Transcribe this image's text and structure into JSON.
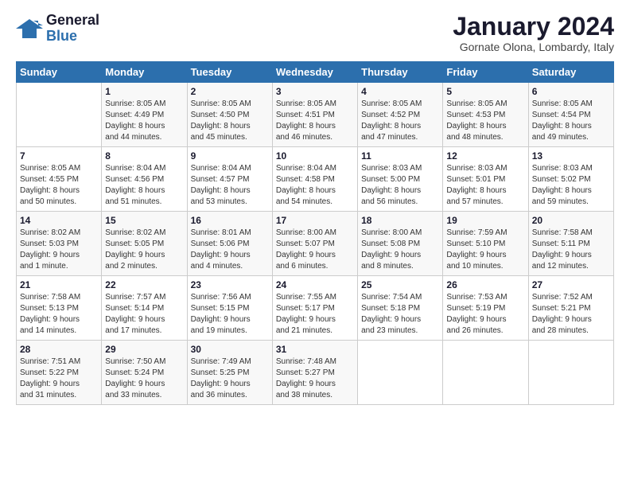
{
  "logo": {
    "text_general": "General",
    "text_blue": "Blue"
  },
  "header": {
    "title": "January 2024",
    "subtitle": "Gornate Olona, Lombardy, Italy"
  },
  "weekdays": [
    "Sunday",
    "Monday",
    "Tuesday",
    "Wednesday",
    "Thursday",
    "Friday",
    "Saturday"
  ],
  "weeks": [
    [
      {
        "num": "",
        "detail": ""
      },
      {
        "num": "1",
        "detail": "Sunrise: 8:05 AM\nSunset: 4:49 PM\nDaylight: 8 hours\nand 44 minutes."
      },
      {
        "num": "2",
        "detail": "Sunrise: 8:05 AM\nSunset: 4:50 PM\nDaylight: 8 hours\nand 45 minutes."
      },
      {
        "num": "3",
        "detail": "Sunrise: 8:05 AM\nSunset: 4:51 PM\nDaylight: 8 hours\nand 46 minutes."
      },
      {
        "num": "4",
        "detail": "Sunrise: 8:05 AM\nSunset: 4:52 PM\nDaylight: 8 hours\nand 47 minutes."
      },
      {
        "num": "5",
        "detail": "Sunrise: 8:05 AM\nSunset: 4:53 PM\nDaylight: 8 hours\nand 48 minutes."
      },
      {
        "num": "6",
        "detail": "Sunrise: 8:05 AM\nSunset: 4:54 PM\nDaylight: 8 hours\nand 49 minutes."
      }
    ],
    [
      {
        "num": "7",
        "detail": "Sunrise: 8:05 AM\nSunset: 4:55 PM\nDaylight: 8 hours\nand 50 minutes."
      },
      {
        "num": "8",
        "detail": "Sunrise: 8:04 AM\nSunset: 4:56 PM\nDaylight: 8 hours\nand 51 minutes."
      },
      {
        "num": "9",
        "detail": "Sunrise: 8:04 AM\nSunset: 4:57 PM\nDaylight: 8 hours\nand 53 minutes."
      },
      {
        "num": "10",
        "detail": "Sunrise: 8:04 AM\nSunset: 4:58 PM\nDaylight: 8 hours\nand 54 minutes."
      },
      {
        "num": "11",
        "detail": "Sunrise: 8:03 AM\nSunset: 5:00 PM\nDaylight: 8 hours\nand 56 minutes."
      },
      {
        "num": "12",
        "detail": "Sunrise: 8:03 AM\nSunset: 5:01 PM\nDaylight: 8 hours\nand 57 minutes."
      },
      {
        "num": "13",
        "detail": "Sunrise: 8:03 AM\nSunset: 5:02 PM\nDaylight: 8 hours\nand 59 minutes."
      }
    ],
    [
      {
        "num": "14",
        "detail": "Sunrise: 8:02 AM\nSunset: 5:03 PM\nDaylight: 9 hours\nand 1 minute."
      },
      {
        "num": "15",
        "detail": "Sunrise: 8:02 AM\nSunset: 5:05 PM\nDaylight: 9 hours\nand 2 minutes."
      },
      {
        "num": "16",
        "detail": "Sunrise: 8:01 AM\nSunset: 5:06 PM\nDaylight: 9 hours\nand 4 minutes."
      },
      {
        "num": "17",
        "detail": "Sunrise: 8:00 AM\nSunset: 5:07 PM\nDaylight: 9 hours\nand 6 minutes."
      },
      {
        "num": "18",
        "detail": "Sunrise: 8:00 AM\nSunset: 5:08 PM\nDaylight: 9 hours\nand 8 minutes."
      },
      {
        "num": "19",
        "detail": "Sunrise: 7:59 AM\nSunset: 5:10 PM\nDaylight: 9 hours\nand 10 minutes."
      },
      {
        "num": "20",
        "detail": "Sunrise: 7:58 AM\nSunset: 5:11 PM\nDaylight: 9 hours\nand 12 minutes."
      }
    ],
    [
      {
        "num": "21",
        "detail": "Sunrise: 7:58 AM\nSunset: 5:13 PM\nDaylight: 9 hours\nand 14 minutes."
      },
      {
        "num": "22",
        "detail": "Sunrise: 7:57 AM\nSunset: 5:14 PM\nDaylight: 9 hours\nand 17 minutes."
      },
      {
        "num": "23",
        "detail": "Sunrise: 7:56 AM\nSunset: 5:15 PM\nDaylight: 9 hours\nand 19 minutes."
      },
      {
        "num": "24",
        "detail": "Sunrise: 7:55 AM\nSunset: 5:17 PM\nDaylight: 9 hours\nand 21 minutes."
      },
      {
        "num": "25",
        "detail": "Sunrise: 7:54 AM\nSunset: 5:18 PM\nDaylight: 9 hours\nand 23 minutes."
      },
      {
        "num": "26",
        "detail": "Sunrise: 7:53 AM\nSunset: 5:19 PM\nDaylight: 9 hours\nand 26 minutes."
      },
      {
        "num": "27",
        "detail": "Sunrise: 7:52 AM\nSunset: 5:21 PM\nDaylight: 9 hours\nand 28 minutes."
      }
    ],
    [
      {
        "num": "28",
        "detail": "Sunrise: 7:51 AM\nSunset: 5:22 PM\nDaylight: 9 hours\nand 31 minutes."
      },
      {
        "num": "29",
        "detail": "Sunrise: 7:50 AM\nSunset: 5:24 PM\nDaylight: 9 hours\nand 33 minutes."
      },
      {
        "num": "30",
        "detail": "Sunrise: 7:49 AM\nSunset: 5:25 PM\nDaylight: 9 hours\nand 36 minutes."
      },
      {
        "num": "31",
        "detail": "Sunrise: 7:48 AM\nSunset: 5:27 PM\nDaylight: 9 hours\nand 38 minutes."
      },
      {
        "num": "",
        "detail": ""
      },
      {
        "num": "",
        "detail": ""
      },
      {
        "num": "",
        "detail": ""
      }
    ]
  ]
}
